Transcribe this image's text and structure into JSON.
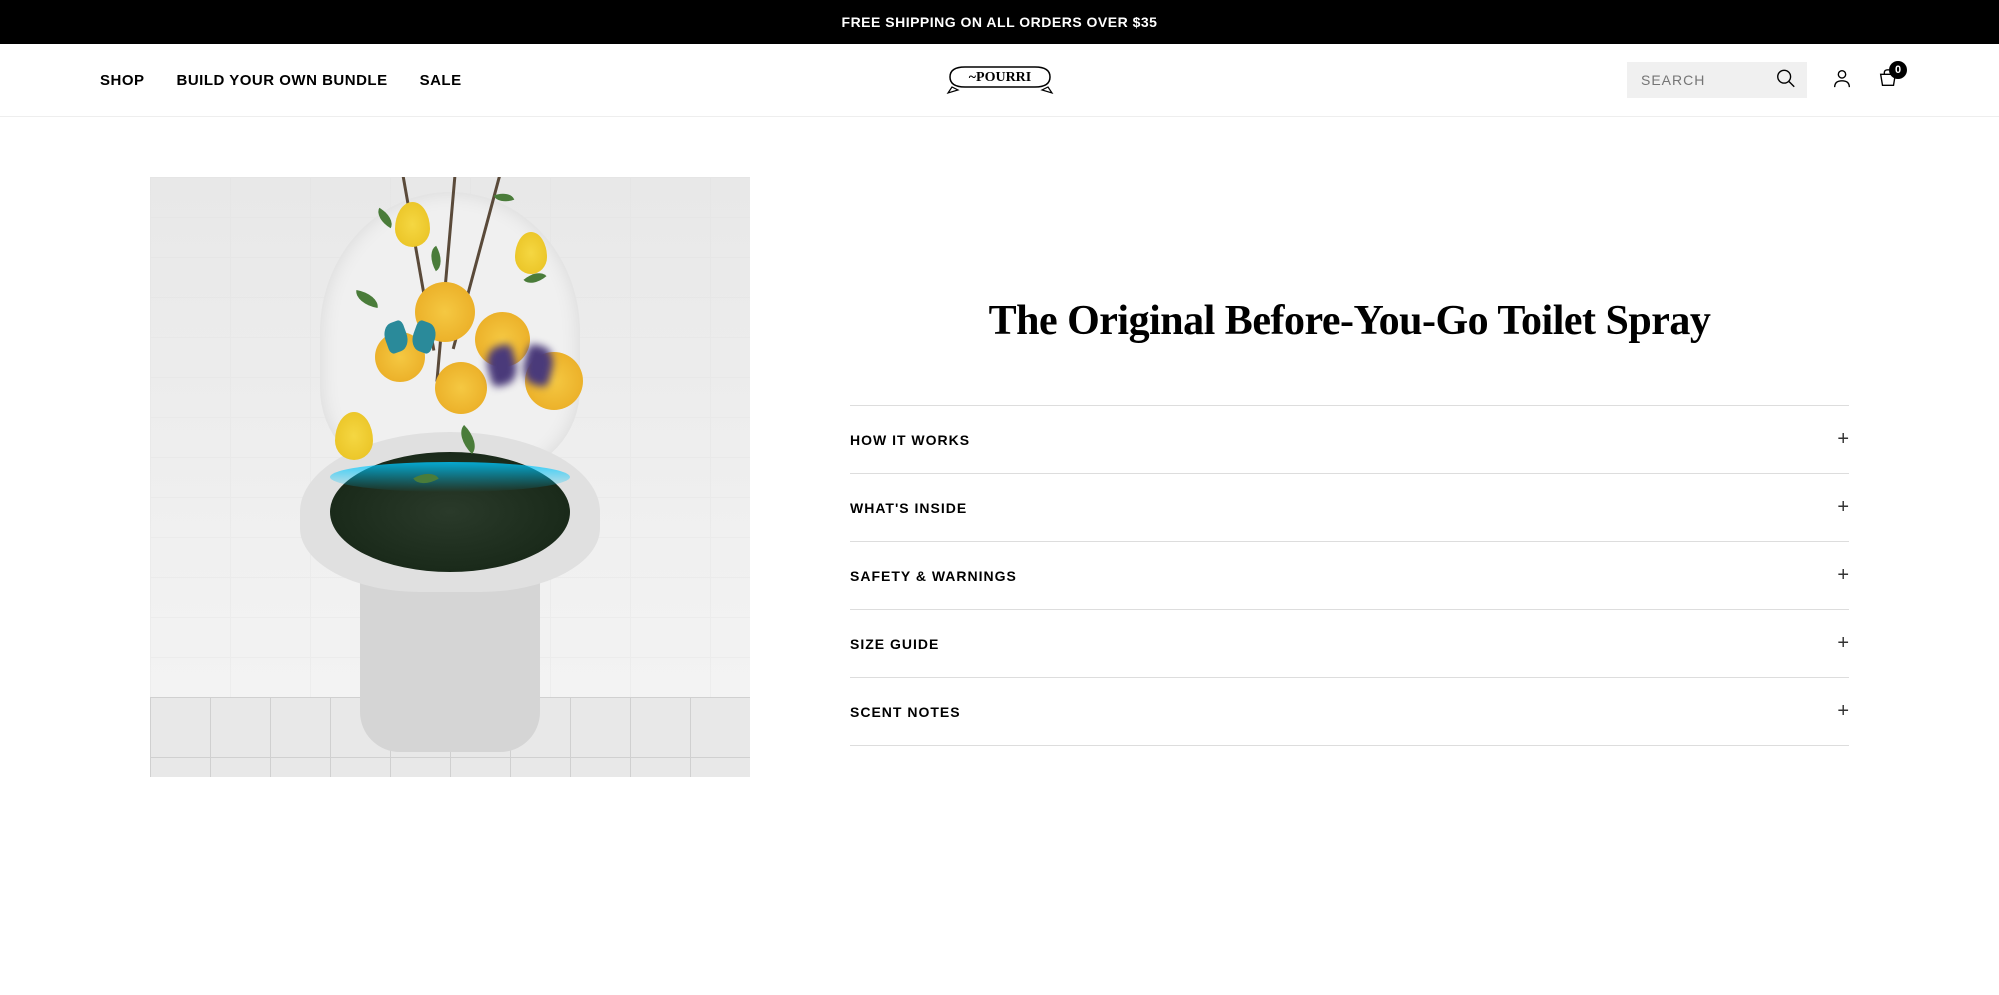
{
  "announcement": "FREE SHIPPING ON ALL ORDERS OVER $35",
  "nav": {
    "shop": "SHOP",
    "bundle": "BUILD YOUR OWN BUNDLE",
    "sale": "SALE"
  },
  "logo_text": "POURRI",
  "search": {
    "placeholder": "SEARCH"
  },
  "cart": {
    "count": "0"
  },
  "product": {
    "title": "The Original Before-You-Go Toilet Spray"
  },
  "accordion": {
    "items": [
      {
        "label": "HOW IT WORKS"
      },
      {
        "label": "WHAT'S INSIDE"
      },
      {
        "label": "SAFETY & WARNINGS"
      },
      {
        "label": "SIZE GUIDE"
      },
      {
        "label": "SCENT NOTES"
      }
    ]
  }
}
